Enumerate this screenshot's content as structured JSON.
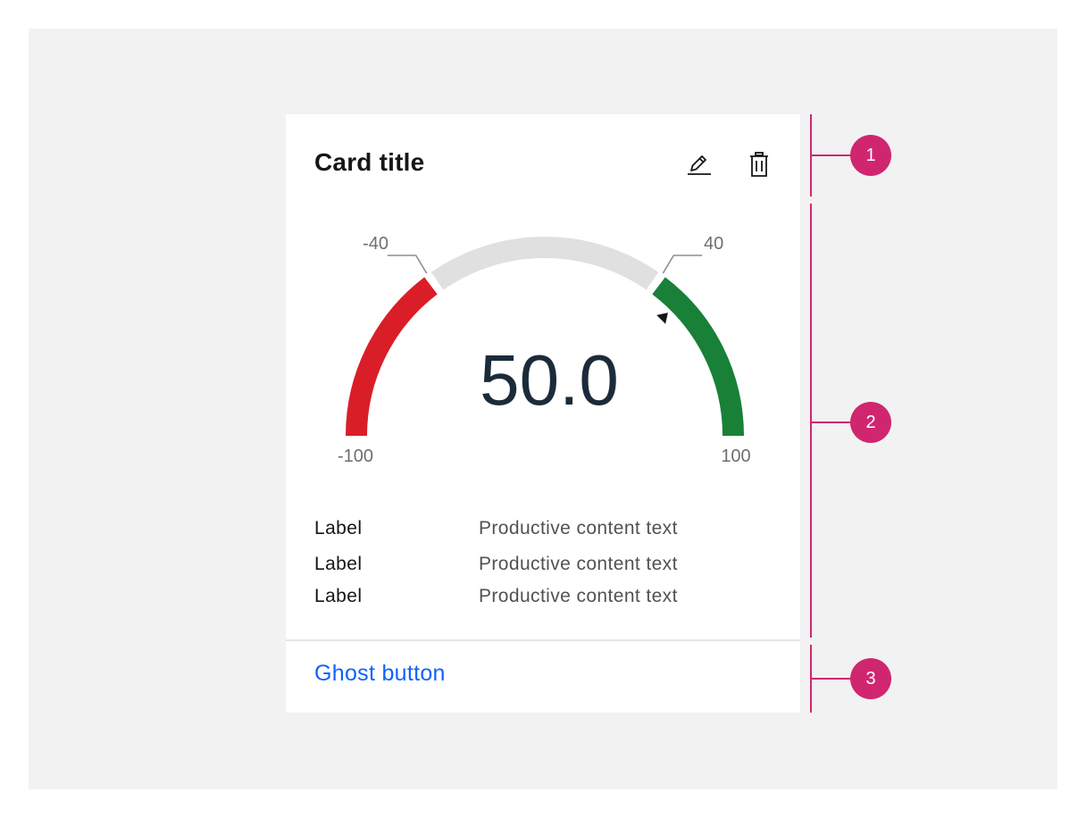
{
  "card": {
    "title": "Card title",
    "actions": {
      "edit_icon": "pencil-icon",
      "delete_icon": "trash-icon"
    },
    "gauge": {
      "value_text": "50.0",
      "value": 50,
      "min": -100,
      "max": 100,
      "thresholds": [
        -40,
        40
      ],
      "labels": {
        "min": "-100",
        "max": "100",
        "low_threshold": "-40",
        "high_threshold": "40"
      },
      "colors": {
        "low": "#da1e28",
        "mid": "#e0e0e0",
        "high": "#198038",
        "marker": "#161616"
      }
    },
    "rows": [
      {
        "label": "Label",
        "value": "Productive content text"
      },
      {
        "label": "Label",
        "value": "Productive content text"
      },
      {
        "label": "Label",
        "value": "Productive content text"
      }
    ],
    "footer": {
      "ghost_button": "Ghost button"
    }
  },
  "callouts": [
    "1",
    "2",
    "3"
  ],
  "colors": {
    "accent": "#d02670",
    "link": "#0f62fe",
    "background": "#f2f2f2"
  }
}
